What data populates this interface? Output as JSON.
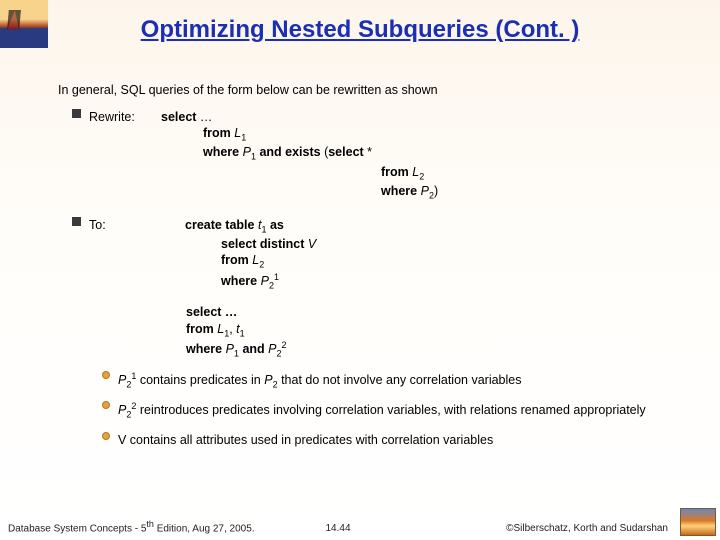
{
  "title": "Optimizing Nested Subqueries (Cont. )",
  "intro": "In general, SQL queries of the form below can be rewritten as shown",
  "rewrite_label": "Rewrite:",
  "rewrite": {
    "l1a": "select",
    "l1b": " …",
    "l2a": "from ",
    "l2b": "L",
    "l2sub": "1",
    "l3a": "where ",
    "l3b": "P",
    "l3sub": "1",
    "l3c": " and exists ",
    "l3d": "(",
    "l3e": "select ",
    "l3f": "*",
    "l4a": "from ",
    "l4b": "L",
    "l4sub": "2",
    "l5a": "where ",
    "l5b": "P",
    "l5sub": "2",
    "l5c": ")"
  },
  "to_label": "To:",
  "to": {
    "l1a": "create table ",
    "l1b": "t",
    "l1sub": "1",
    "l1c": " as",
    "l2a": "select distinct ",
    "l2b": "V",
    "l3a": "from ",
    "l3b": "L",
    "l3sub": "2",
    "l4a": "where ",
    "l4b": "P",
    "l4sub": "2",
    "l4sup": "1"
  },
  "sel": {
    "l1": "select …",
    "l2a": "from ",
    "l2b": "L",
    "l2sub": "1",
    "l2c": ", ",
    "l2d": "t",
    "l2sub2": "1",
    "l3a": "where ",
    "l3b": "P",
    "l3sub": "1",
    "l3c": " and ",
    "l3d": "P",
    "l3sub2": "2",
    "l3sup2": "2"
  },
  "notes": {
    "n1a": "P",
    "n1sub": "2",
    "n1sup": "1",
    "n1b": " contains predicates in ",
    "n1c": "P",
    "n1sub2": "2",
    "n1d": " that do not involve any correlation variables",
    "n2a": "P",
    "n2sub": "2",
    "n2sup": "2",
    "n2b": "  reintroduces predicates involving correlation variables, with relations renamed appropriately",
    "n3": "V contains all attributes used in predicates with correlation variables"
  },
  "footer": {
    "left_a": "Database System Concepts - 5",
    "left_sup": "th",
    "left_b": " Edition, Aug 27, 2005.",
    "center": "14.44",
    "right": "©Silberschatz, Korth and Sudarshan"
  }
}
